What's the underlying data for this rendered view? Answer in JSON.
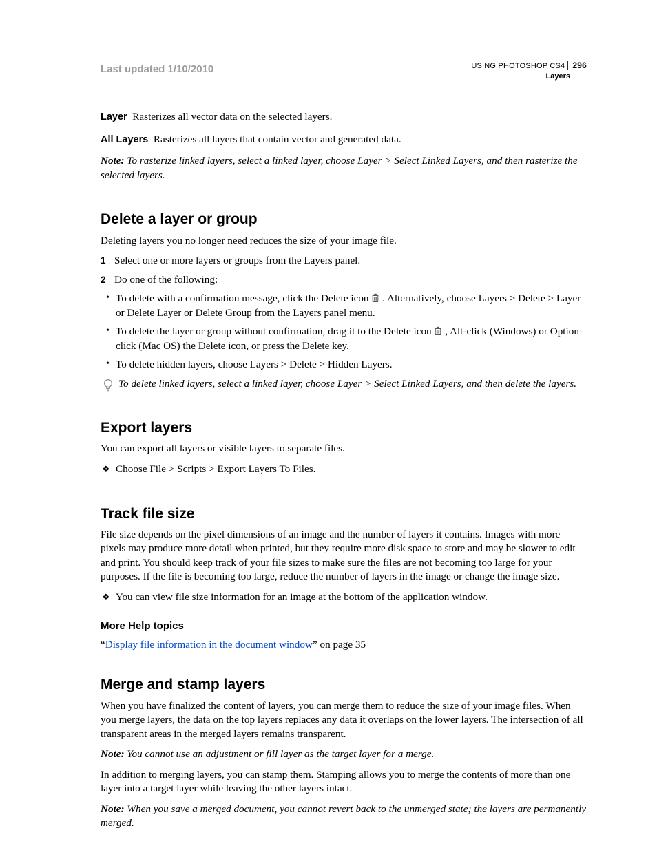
{
  "header": {
    "last_updated": "Last updated 1/10/2010",
    "product": "USING PHOTOSHOP CS4",
    "page_num": "296",
    "chapter": "Layers"
  },
  "defs": {
    "layer_term": "Layer",
    "layer_text": "Rasterizes all vector data on the selected layers.",
    "all_term": "All Layers",
    "all_text": "Rasterizes all layers that contain vector and generated data."
  },
  "note1": {
    "label": "Note:",
    "text": " To rasterize linked layers, select a linked layer, choose Layer > Select Linked Layers, and then rasterize the selected layers."
  },
  "delete": {
    "heading": "Delete a layer or group",
    "intro": "Deleting layers you no longer need reduces the size of your image file.",
    "step1": "Select one or more layers or groups from the Layers panel.",
    "step2": "Do one of the following:",
    "b1a": "To delete with a confirmation message, click the Delete icon ",
    "b1b": " . Alternatively, choose Layers > Delete > Layer or Delete Layer or Delete Group from the Layers panel menu.",
    "b2a": "To delete the layer or group without confirmation, drag it to the Delete icon ",
    "b2b": " , Alt-click (Windows) or Option-click (Mac OS) the Delete icon, or press the Delete key.",
    "b3": "To delete hidden layers, choose Layers > Delete > Hidden Layers.",
    "tip": "To delete linked layers, select a linked layer, choose Layer > Select Linked Layers, and then delete the layers."
  },
  "export": {
    "heading": "Export layers",
    "intro": "You can export all layers or visible layers to separate files.",
    "item": "Choose File > Scripts > Export Layers To Files."
  },
  "track": {
    "heading": "Track file size",
    "para": "File size depends on the pixel dimensions of an image and the number of layers it contains. Images with more pixels may produce more detail when printed, but they require more disk space to store and may be slower to edit and print. You should keep track of your file sizes to make sure the files are not becoming too large for your purposes. If the file is becoming too large, reduce the number of layers in the image or change the image size.",
    "item": "You can view file size information for an image at the bottom of the application window.",
    "more_head": "More Help topics",
    "link_text": "Display file information in the document window",
    "link_suffix": " on page 35"
  },
  "merge": {
    "heading": "Merge and stamp layers",
    "p1": "When you have finalized the content of layers, you can merge them to reduce the size of your image files. When you merge layers, the data on the top layers replaces any data it overlaps on the lower layers. The intersection of all transparent areas in the merged layers remains transparent.",
    "n1_label": "Note:",
    "n1_text": " You cannot use an adjustment or fill layer as the target layer for a merge.",
    "p2": "In addition to merging layers, you can stamp them. Stamping allows you to merge the contents of more than one layer into a target layer while leaving the other layers intact.",
    "n2_label": "Note:",
    "n2_text": " When you save a merged document, you cannot revert back to the unmerged state; the layers are permanently merged."
  }
}
